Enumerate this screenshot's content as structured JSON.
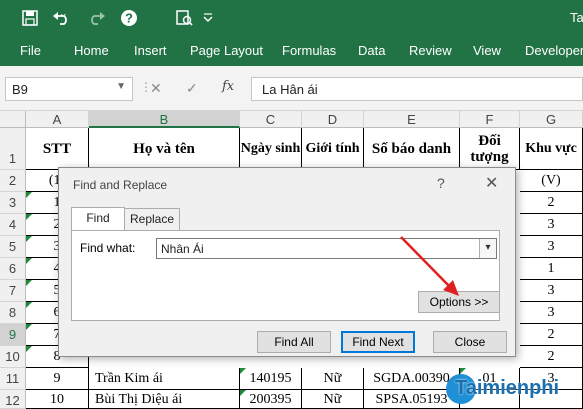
{
  "titlebar": {
    "save_icon": "save-icon",
    "undo_icon": "undo-icon",
    "redo_icon": "redo-icon",
    "help_icon": "help-icon",
    "print_preview_icon": "print-preview-icon",
    "qat_more_icon": "chevron-down-icon",
    "doc_title": "Ta"
  },
  "ribbon_tabs": [
    "File",
    "Home",
    "Insert",
    "Page Layout",
    "Formulas",
    "Data",
    "Review",
    "View",
    "Developer"
  ],
  "formula_bar": {
    "name_box": "B9",
    "cancel_symbol": "✕",
    "enter_symbol": "✓",
    "fx_label": "fx",
    "formula_value": "La Hân ái"
  },
  "columns": [
    "A",
    "B",
    "C",
    "D",
    "E",
    "F",
    "G"
  ],
  "rows": [
    "1",
    "2",
    "3",
    "4",
    "5",
    "6",
    "7",
    "8",
    "9",
    "10",
    "11",
    "12"
  ],
  "header_row": {
    "A": "STT",
    "B": "Họ và tên",
    "C": "Ngày sinh",
    "D": "Giới tính",
    "E": "Số báo danh",
    "F": "Đối tượng",
    "G": "Khu vực"
  },
  "row2": {
    "A": "(1)",
    "G": "(V)"
  },
  "stt": [
    "1",
    "2",
    "3",
    "4",
    "5",
    "6",
    "7",
    "8"
  ],
  "khu_vuc": [
    "2",
    "3",
    "3",
    "1",
    "3",
    "3",
    "2",
    "2"
  ],
  "row11": {
    "A": "9",
    "B": "Trần Kim ái",
    "C": "140195",
    "D": "Nữ",
    "E": "SGDA.00390",
    "F": "01",
    "G": "3"
  },
  "row12": {
    "A": "10",
    "B": "Bùi Thị Diệu ái",
    "C": "200395",
    "D": "Nữ",
    "E": "SPSA.05193",
    "F": "",
    "G": ""
  },
  "dialog": {
    "title": "Find and Replace",
    "help": "?",
    "close": "✕",
    "tab_find": "Find",
    "tab_replace": "Replace",
    "find_what_label": "Find what:",
    "find_what_value": "Nhân Ái",
    "options_button": "Options >>",
    "find_all_button": "Find All",
    "find_next_button": "Find Next",
    "close_button": "Close"
  },
  "watermark": "Taimienphi",
  "colors": {
    "excel_green": "#217346",
    "arrow_red": "#e02020",
    "triangle_green": "#1e8a3a"
  }
}
